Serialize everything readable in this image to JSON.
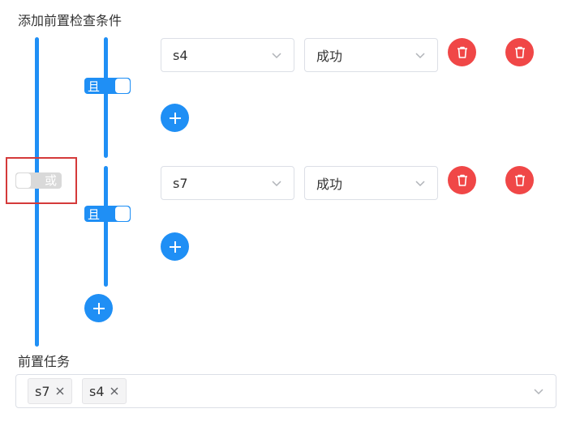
{
  "header": {
    "title": "添加前置检查条件"
  },
  "outer_group": {
    "toggle_label": "或",
    "toggle_state": "off"
  },
  "groups": [
    {
      "toggle_label": "且",
      "toggle_state": "on",
      "rows": [
        {
          "task": "s4",
          "status": "成功"
        }
      ]
    },
    {
      "toggle_label": "且",
      "toggle_state": "on",
      "rows": [
        {
          "task": "s7",
          "status": "成功"
        }
      ]
    }
  ],
  "pre_tasks": {
    "label": "前置任务",
    "tags": [
      "s7",
      "s4"
    ]
  },
  "icons": {
    "delete": "trash-icon",
    "add": "plus-icon",
    "dropdown": "chevron-down-icon",
    "remove_tag": "close-icon"
  },
  "colors": {
    "accent": "#1f8ff5",
    "danger": "#f04747",
    "highlight": "#d43a3a"
  }
}
